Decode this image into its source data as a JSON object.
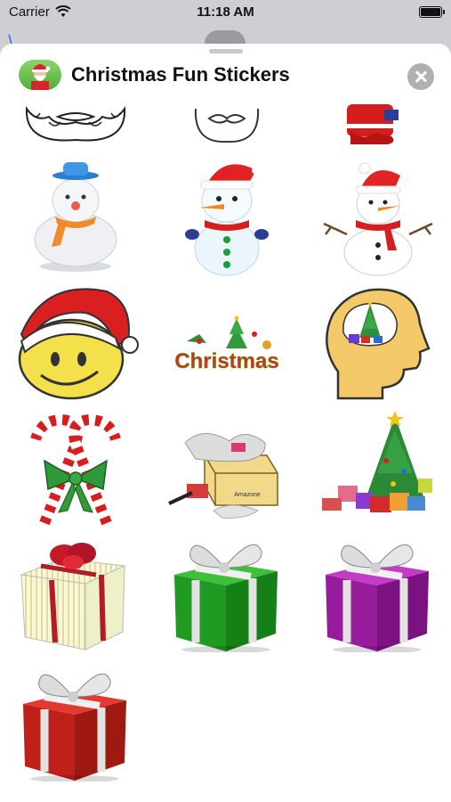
{
  "status_bar": {
    "carrier": "Carrier",
    "time": "11:18 AM"
  },
  "header": {
    "title": "Christmas Fun Stickers"
  },
  "stickers": [
    {
      "name": "santa-beard-outline"
    },
    {
      "name": "santa-beard-white"
    },
    {
      "name": "santa-suit"
    },
    {
      "name": "snowman-blue-hat"
    },
    {
      "name": "snowman-santa-hat"
    },
    {
      "name": "snowman-scarf"
    },
    {
      "name": "smiley-santa-hat"
    },
    {
      "name": "christmas-text",
      "text": "Christmas"
    },
    {
      "name": "head-with-tree"
    },
    {
      "name": "candy-canes-bow"
    },
    {
      "name": "amazon-box",
      "text": "Amazone"
    },
    {
      "name": "tree-with-presents"
    },
    {
      "name": "gift-striped-red-bow"
    },
    {
      "name": "gift-green"
    },
    {
      "name": "gift-purple"
    },
    {
      "name": "gift-red"
    }
  ]
}
